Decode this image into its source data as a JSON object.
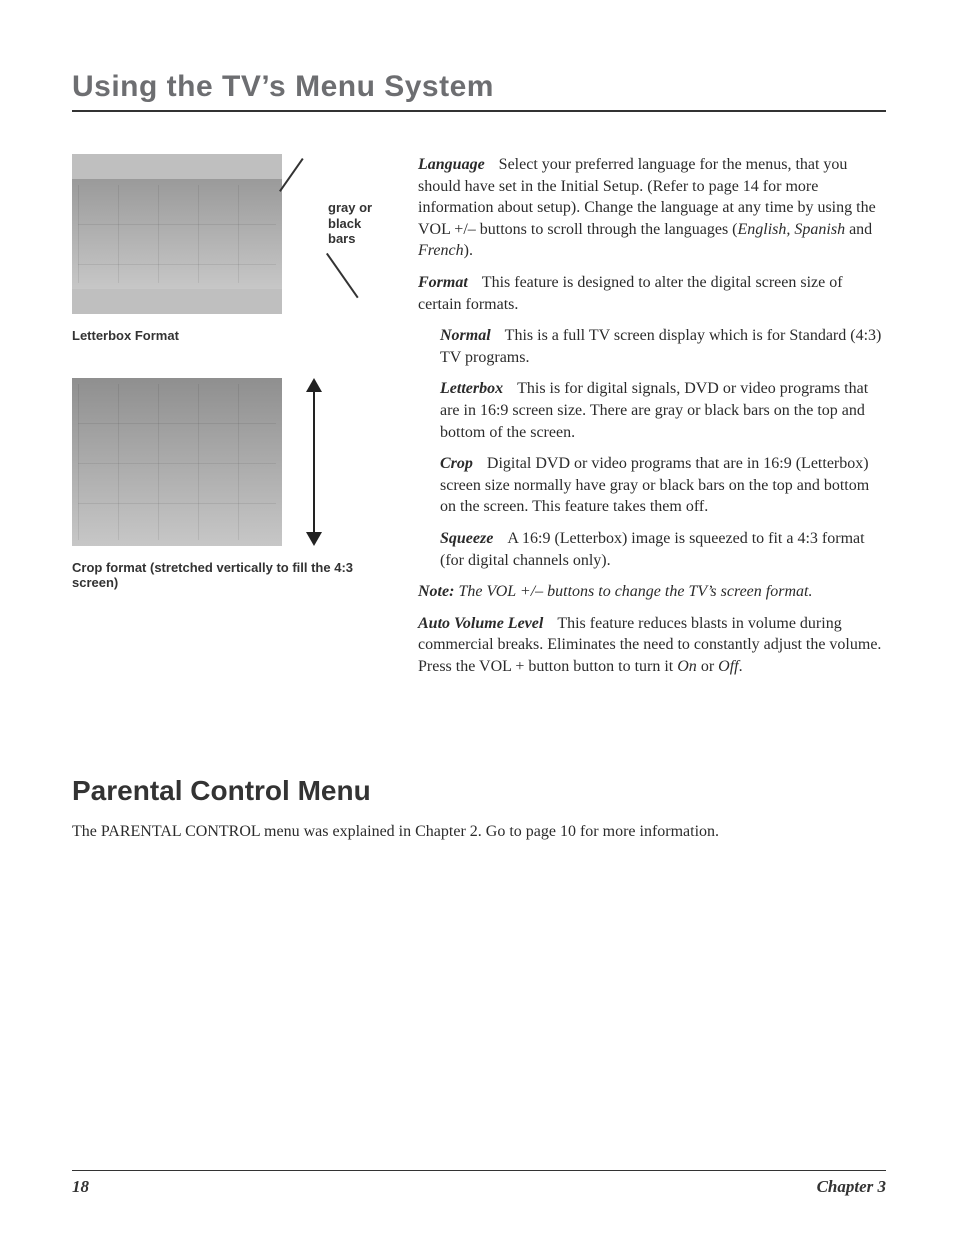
{
  "title": "Using the TV’s Menu System",
  "figures": {
    "callout": "gray or black bars",
    "letterbox_caption": "Letterbox Format",
    "crop_caption": "Crop format (stretched vertically to fill the 4:3 screen)"
  },
  "body": {
    "language_term": "Language",
    "language_text_1": "Select your preferred language for the menus, that you should have set in the Initial Setup. (Refer to page 14 for more information about setup). Change the language at any time by using the VOL +/– buttons to scroll through the languages (",
    "language_langs": "English, Spanish",
    "language_and": " and ",
    "language_french": "French",
    "language_close": ").",
    "format_term": "Format",
    "format_text": "This feature is designed to alter the digital screen size of certain formats.",
    "normal_term": "Normal",
    "normal_text": "This is a full TV screen display which is for Standard (4:3) TV programs.",
    "letterbox_term": "Letterbox",
    "letterbox_text": "This is for digital signals, DVD or video programs that are in 16:9 screen size. There are gray or black bars on the top and bottom of the screen.",
    "crop_term": "Crop",
    "crop_text": "Digital DVD or video programs that are in 16:9 (Letterbox) screen size normally have gray or black bars on the top and bottom on the screen. This feature takes them off.",
    "squeeze_term": "Squeeze",
    "squeeze_text": "A 16:9 (Letterbox) image is squeezed to fit a 4:3 format (for digital channels only).",
    "note_label": "Note:",
    "note_text": " The VOL +/– buttons to change the TV’s screen format.",
    "auto_term": "Auto Volume Level",
    "auto_text_1": "This feature reduces blasts in volume during commercial breaks. Eliminates the need to constantly adjust the volume. Press the VOL + button button to turn it ",
    "auto_on": "On",
    "auto_or": " or ",
    "auto_off": "Off",
    "auto_period": "."
  },
  "section2": {
    "title": "Parental Control Menu",
    "text": "The PARENTAL CONTROL menu was explained in Chapter 2.  Go to page 10 for more information."
  },
  "footer": {
    "page": "18",
    "chapter": "Chapter 3"
  }
}
